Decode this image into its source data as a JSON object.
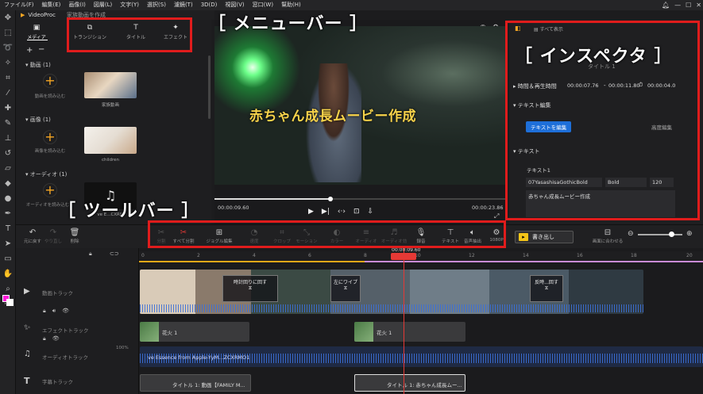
{
  "menu": [
    "ファイル(F)",
    "編集(E)",
    "画像(I)",
    "図層(L)",
    "文字(Y)",
    "選択(S)",
    "濾鏡(T)",
    "3D(D)",
    "視図(V)",
    "窓口(W)",
    "幫助(H)"
  ],
  "app": {
    "name": "VideoProc",
    "project": "家族動画を作成"
  },
  "media_tabs": [
    "メディア",
    "トランジション",
    "タイトル",
    "エフェクト"
  ],
  "media": {
    "video_section": "動画 (1)",
    "video_add": "動画を読み込む",
    "video_thumb_label": "家族動画",
    "image_section": "画像 (1)",
    "image_add": "画像を読み込む",
    "image_thumb_label": "children",
    "audio_section": "オーディオ (1)",
    "audio_add": "オーディオを読み込む",
    "audio_thumb_label": "ve E...CXRM"
  },
  "preview": {
    "title_text": "赤ちゃん成長ムービー作成",
    "time_current": "00:00:09.60",
    "time_total": "00:00:23.86",
    "progress": 0.4
  },
  "inspector": {
    "show_all": "すべて表示",
    "clip_name": "タイトル 1",
    "time_section": "時間＆再生時間",
    "start": "00:00:07.76",
    "end": "00:00:11.80",
    "duration": "00:00:04.0",
    "text_edit_section": "テキスト編集",
    "edit_text_button": "テキストを編集",
    "advanced_edit": "高度編集",
    "text_section": "テキスト",
    "text_item": "テキスト1",
    "font": "07YasashisaGothicBold",
    "weight": "Bold",
    "size": "120",
    "text_value": "赤ちゃん成長ムービー作成"
  },
  "annotations": {
    "menubar": "［ メニューバー ］",
    "inspector": "［ インスペクタ ］",
    "toolbar": "［ ツールバー ］"
  },
  "toolbar": {
    "undo": "元に戻す",
    "redo": "やり直し",
    "delete": "削除",
    "split": "分割",
    "split_all": "すべて分割",
    "jog": "ジョグル編集",
    "speed": "速度",
    "crop": "クロップ",
    "motion": "モーション",
    "color": "カラー",
    "audio": "オーディオ",
    "audio_fade": "オーディオ効",
    "record": "録音",
    "text": "テキスト",
    "detach": "音声抽出",
    "res": "1080P",
    "export": "書き出し",
    "fit": "画面に合わせる"
  },
  "timeline": {
    "timecode": "00:00:09.60",
    "ruler": [
      "0",
      "2",
      "4",
      "6",
      "8",
      "10",
      "12",
      "14",
      "16",
      "18",
      "20"
    ],
    "tracks": [
      "動画トラック",
      "エフェクトトラック",
      "オーディオトラック",
      "字幕トラック"
    ],
    "transitions": [
      "時計回りに回す",
      "左にワイプ",
      "反時...回す"
    ],
    "effect_clip": "花火 1",
    "audio_clip": "ve Essence from Apple-YyM...ZCXRMO1",
    "title_clips": [
      "タイトル 1: 動画【FAMILY M...",
      "タイトル 1: 赤ちゃん成長ムー..."
    ],
    "volume": "100%"
  },
  "colors": {
    "accent": "#f5a623",
    "annotation": "#e01c1c",
    "blue": "#1e6fd9",
    "playhead": "#e53935"
  }
}
